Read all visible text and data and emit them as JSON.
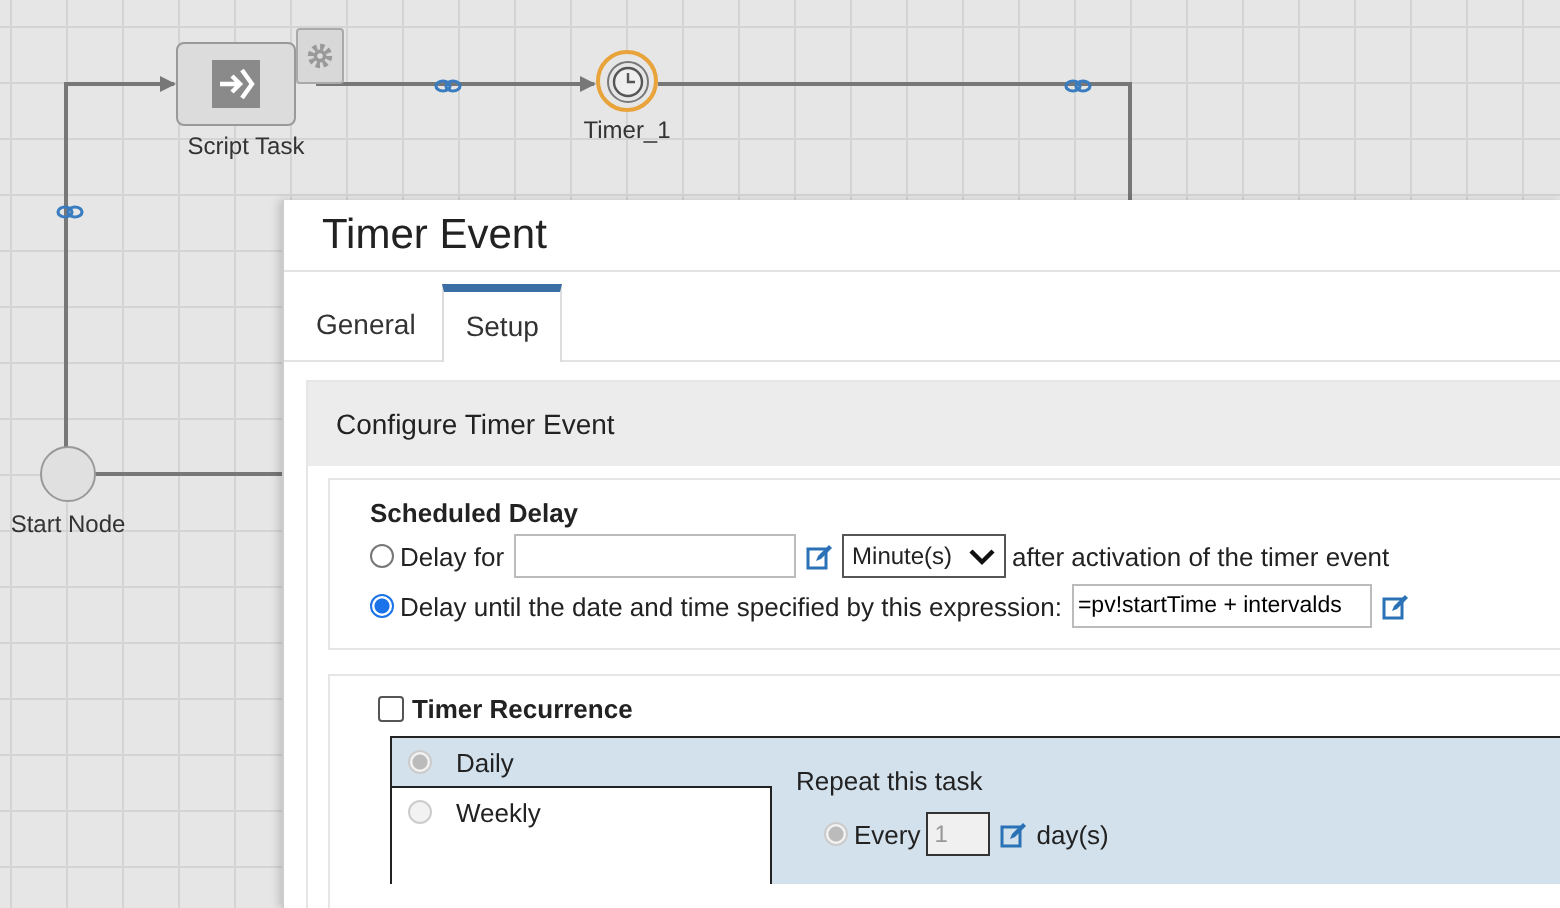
{
  "canvas": {
    "nodes": [
      {
        "kind": "script",
        "label": "Script Task"
      },
      {
        "kind": "timer",
        "label": "Timer_1",
        "selected": true
      },
      {
        "kind": "start",
        "label": "Start Node"
      }
    ]
  },
  "dialog": {
    "title": "Timer Event",
    "tabs": [
      {
        "label": "General",
        "selected": false
      },
      {
        "label": "Setup",
        "selected": true
      }
    ],
    "panel_title": "Configure Timer Event",
    "scheduled_delay": {
      "title": "Scheduled Delay",
      "options": [
        {
          "kind": "duration",
          "label": "Delay for",
          "unit": "Minute(s)",
          "suffix": "after activation of the timer event",
          "selected": false
        },
        {
          "kind": "expression",
          "label": "Delay until the date and time specified by this expression:",
          "value": "=pv!startTime + intervalds",
          "selected": true
        }
      ]
    },
    "recurrence": {
      "label": "Timer Recurrence",
      "checked": false,
      "disabled": true,
      "frequencies": [
        {
          "label": "Daily",
          "selected": true
        },
        {
          "label": "Weekly",
          "selected": false
        }
      ],
      "repeat_title": "Repeat this task",
      "every": {
        "label": "Every",
        "value": "1",
        "unit": "day(s)",
        "selected": true
      }
    }
  }
}
